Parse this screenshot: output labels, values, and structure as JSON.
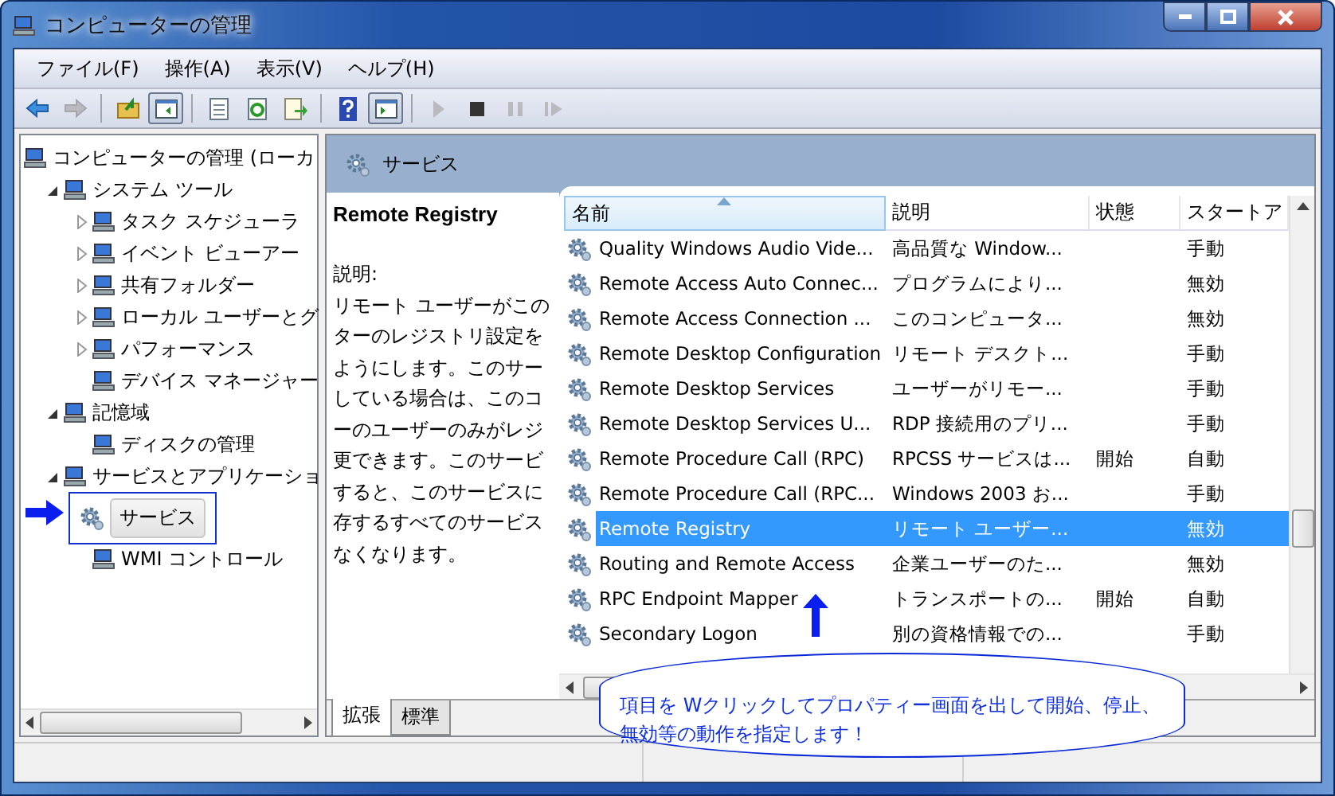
{
  "window": {
    "title": "コンピューターの管理"
  },
  "menu": [
    "ファイル(F)",
    "操作(A)",
    "表示(V)",
    "ヘルプ(H)"
  ],
  "toolbar": [
    {
      "kind": "back",
      "pressed": false,
      "disabled": false
    },
    {
      "kind": "forward",
      "pressed": false,
      "disabled": true
    },
    {
      "kind": "sep"
    },
    {
      "kind": "up",
      "pressed": false,
      "disabled": false
    },
    {
      "kind": "tree",
      "pressed": true,
      "disabled": false
    },
    {
      "kind": "sep"
    },
    {
      "kind": "properties",
      "pressed": false,
      "disabled": false
    },
    {
      "kind": "refresh",
      "pressed": false,
      "disabled": false
    },
    {
      "kind": "export",
      "pressed": false,
      "disabled": false
    },
    {
      "kind": "sep"
    },
    {
      "kind": "help",
      "pressed": false,
      "disabled": false
    },
    {
      "kind": "actionpane",
      "pressed": true,
      "disabled": false
    },
    {
      "kind": "sep"
    },
    {
      "kind": "play",
      "pressed": false,
      "disabled": true
    },
    {
      "kind": "stop",
      "pressed": false,
      "disabled": false
    },
    {
      "kind": "pause",
      "pressed": false,
      "disabled": true
    },
    {
      "kind": "resume",
      "pressed": false,
      "disabled": true
    }
  ],
  "tree": [
    {
      "label": "コンピューターの管理 (ローカ",
      "selected": false,
      "children": [
        {
          "label": "システム ツール",
          "expanded": true,
          "selected": false,
          "children": [
            {
              "label": "タスク スケジューラ",
              "expanded": false,
              "selected": false
            },
            {
              "label": "イベント ビューアー",
              "expanded": false,
              "selected": false
            },
            {
              "label": "共有フォルダー",
              "expanded": false,
              "selected": false
            },
            {
              "label": "ローカル ユーザーとグ",
              "expanded": false,
              "selected": false
            },
            {
              "label": "パフォーマンス",
              "expanded": false,
              "selected": false
            },
            {
              "label": "デバイス マネージャー",
              "selected": false
            }
          ]
        },
        {
          "label": "記憶域",
          "expanded": true,
          "selected": false,
          "children": [
            {
              "label": "ディスクの管理",
              "selected": false
            }
          ]
        },
        {
          "label": "サービスとアプリケーショ",
          "expanded": true,
          "selected": false,
          "children": [
            {
              "label": "サービス",
              "selected": true
            },
            {
              "label": "WMI コントロール",
              "selected": false
            }
          ]
        }
      ]
    }
  ],
  "panel_header": {
    "title": "サービス"
  },
  "details": {
    "name": "Remote Registry",
    "label": "説明:",
    "lines": [
      "リモート ユーザーがこの",
      "ターのレジストリ設定を",
      "ようにします。このサー",
      "している場合は、このコ",
      "ーのユーザーのみがレジ",
      "更できます。このサービ",
      "すると、このサービスに",
      "存するすべてのサービス",
      "なくなります。"
    ]
  },
  "table": {
    "columns": [
      {
        "label": "名前",
        "sorted": true
      },
      {
        "label": "説明",
        "sorted": false
      },
      {
        "label": "状態",
        "sorted": false
      },
      {
        "label": "スタートア",
        "sorted": false
      }
    ],
    "rows": [
      {
        "cells": [
          "Quality Windows Audio Vide...",
          "高品質な Window...",
          "",
          "手動"
        ],
        "selected": false
      },
      {
        "cells": [
          "Remote Access Auto Connec...",
          "プログラムにより...",
          "",
          "無効"
        ],
        "selected": false
      },
      {
        "cells": [
          "Remote Access Connection ...",
          "このコンピュータ...",
          "",
          "無効"
        ],
        "selected": false
      },
      {
        "cells": [
          "Remote Desktop Configuration",
          "リモート デスクト...",
          "",
          "手動"
        ],
        "selected": false
      },
      {
        "cells": [
          "Remote Desktop Services",
          "ユーザーがリモー...",
          "",
          "手動"
        ],
        "selected": false
      },
      {
        "cells": [
          "Remote Desktop Services U...",
          "RDP 接続用のプリ...",
          "",
          "手動"
        ],
        "selected": false
      },
      {
        "cells": [
          "Remote Procedure Call (RPC)",
          "RPCSS サービスは...",
          "開始",
          "自動"
        ],
        "selected": false
      },
      {
        "cells": [
          "Remote Procedure Call (RPC...",
          "Windows 2003 お...",
          "",
          "手動"
        ],
        "selected": false
      },
      {
        "cells": [
          "Remote Registry",
          "リモート ユーザー...",
          "",
          "無効"
        ],
        "selected": true
      },
      {
        "cells": [
          "Routing and Remote Access",
          "企業ユーザーのた...",
          "",
          "無効"
        ],
        "selected": false
      },
      {
        "cells": [
          "RPC Endpoint Mapper",
          "トランスポートの...",
          "開始",
          "自動"
        ],
        "selected": false
      },
      {
        "cells": [
          "Secondary Logon",
          "別の資格情報での...",
          "",
          "手動"
        ],
        "selected": false
      }
    ]
  },
  "tabs": [
    {
      "label": "拡張",
      "selected": true
    },
    {
      "label": "標準",
      "selected": false
    }
  ],
  "callout": {
    "lines": [
      "項目を Wクリックしてプロパティー画面を出して開始、停止、",
      "無効等の動作を指定します！"
    ]
  }
}
